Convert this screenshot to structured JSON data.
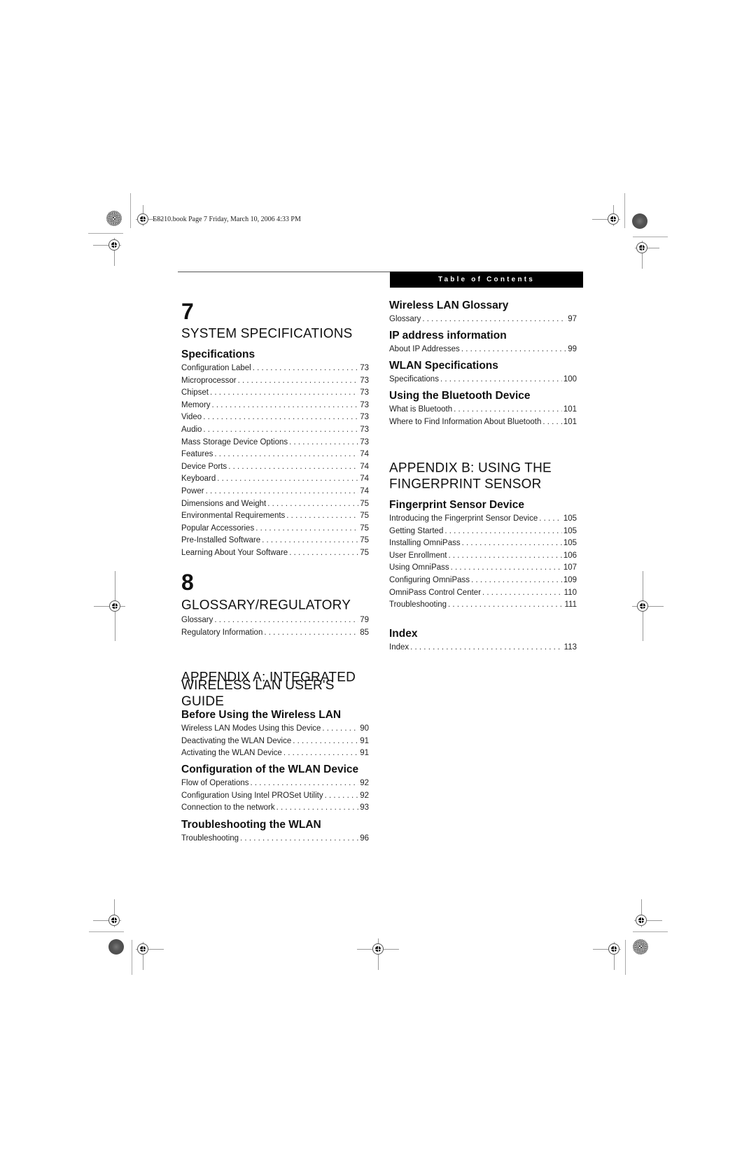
{
  "slug": "E8210.book  Page 7  Friday, March 10, 2006  4:33 PM",
  "header": {
    "section_label": "Table of Contents"
  },
  "left_column": {
    "chapter7": {
      "number": "7",
      "title": "SYSTEM SPECIFICATIONS",
      "sections": [
        {
          "heading": "Specifications",
          "entries": [
            {
              "label": "Configuration Label",
              "page": "73"
            },
            {
              "label": "Microprocessor",
              "page": "73"
            },
            {
              "label": "Chipset",
              "page": "73"
            },
            {
              "label": "Memory",
              "page": "73"
            },
            {
              "label": "Video",
              "page": "73"
            },
            {
              "label": "Audio",
              "page": "73"
            },
            {
              "label": "Mass Storage Device Options",
              "page": "73"
            },
            {
              "label": "Features",
              "page": "74"
            },
            {
              "label": "Device Ports",
              "page": "74"
            },
            {
              "label": "Keyboard",
              "page": "74"
            },
            {
              "label": "Power",
              "page": "74"
            },
            {
              "label": "Dimensions and Weight",
              "page": "75"
            },
            {
              "label": "Environmental Requirements",
              "page": "75"
            },
            {
              "label": "Popular Accessories",
              "page": "75"
            },
            {
              "label": "Pre-Installed Software",
              "page": "75"
            },
            {
              "label": "Learning About Your Software",
              "page": "75"
            }
          ]
        }
      ]
    },
    "chapter8": {
      "number": "8",
      "title": "GLOSSARY/REGULATORY",
      "entries": [
        {
          "label": "Glossary",
          "page": "79"
        },
        {
          "label": "Regulatory Information",
          "page": "85"
        }
      ]
    },
    "appendixA": {
      "title_line1": "APPENDIX A: INTEGRATED",
      "title_line2": "WIRELESS LAN USER'S GUIDE",
      "sections": [
        {
          "heading": "Before Using the Wireless LAN",
          "entries": [
            {
              "label": "Wireless LAN Modes Using this Device",
              "page": "90"
            },
            {
              "label": "Deactivating the WLAN Device",
              "page": "91"
            },
            {
              "label": "Activating the WLAN Device",
              "page": "91"
            }
          ]
        },
        {
          "heading": "Configuration of the WLAN Device",
          "entries": [
            {
              "label": "Flow of Operations",
              "page": "92"
            },
            {
              "label": "Configuration Using Intel PROSet Utility",
              "page": "92"
            },
            {
              "label": "Connection to the network",
              "page": "93"
            }
          ]
        },
        {
          "heading": "Troubleshooting the WLAN",
          "entries": [
            {
              "label": "Troubleshooting",
              "page": "96"
            }
          ]
        }
      ]
    }
  },
  "right_column": {
    "appendixA_cont": {
      "sections": [
        {
          "heading": "Wireless LAN Glossary",
          "entries": [
            {
              "label": "Glossary",
              "page": "97"
            }
          ]
        },
        {
          "heading": "IP address information",
          "entries": [
            {
              "label": "About IP Addresses",
              "page": "99"
            }
          ]
        },
        {
          "heading": "WLAN Specifications",
          "entries": [
            {
              "label": "Specifications",
              "page": "100"
            }
          ]
        },
        {
          "heading": "Using the Bluetooth Device",
          "entries": [
            {
              "label": "What is Bluetooth",
              "page": "101"
            },
            {
              "label": "Where to Find Information About Bluetooth",
              "page": "101"
            }
          ]
        }
      ]
    },
    "appendixB": {
      "title_line1": "APPENDIX B: USING THE",
      "title_line2": "FINGERPRINT SENSOR",
      "sections": [
        {
          "heading": "Fingerprint Sensor Device",
          "entries": [
            {
              "label": "Introducing the Fingerprint Sensor Device",
              "page": "105"
            },
            {
              "label": "Getting Started",
              "page": "105"
            },
            {
              "label": "Installing OmniPass",
              "page": "105"
            },
            {
              "label": "User Enrollment",
              "page": "106"
            },
            {
              "label": "Using OmniPass",
              "page": "107"
            },
            {
              "label": "Configuring OmniPass",
              "page": "109"
            },
            {
              "label": "OmniPass Control Center",
              "page": "110"
            },
            {
              "label": "Troubleshooting",
              "page": "111"
            }
          ]
        }
      ]
    },
    "index": {
      "heading": "Index",
      "entries": [
        {
          "label": "Index",
          "page": "113"
        }
      ]
    }
  }
}
